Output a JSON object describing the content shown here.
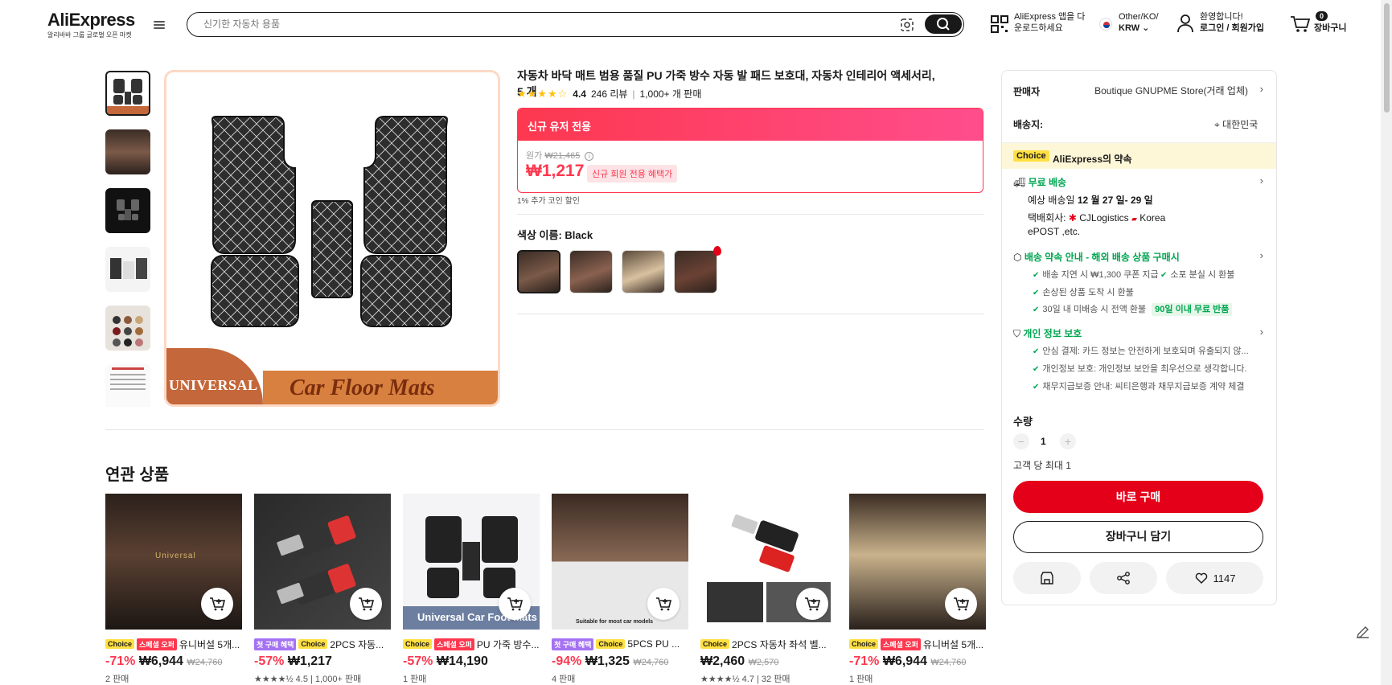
{
  "header": {
    "logo": "AliExpress",
    "logo_sub": "알리바바 그룹 글로벌 오픈 마켓",
    "search_placeholder": "신기한 자동차 용품",
    "app_line1": "AliExpress 앱을 다",
    "app_line2": "운로드하세요",
    "region_line1": "Other/KO/",
    "region_line2": "KRW",
    "account_line1": "환영합니다!",
    "account_line2": "로그인 / 회원가입",
    "cart_count": "0",
    "cart_label": "장바구니"
  },
  "product": {
    "title": "자동차 바닥 매트 범용 품질 PU 가죽 방수 자동 발 패드 보호대, 자동차 인테리어 액세서리, 5 개",
    "rating": "4.4",
    "reviews": "246 리뷰",
    "sold": "1,000+ 개 판매",
    "new_user_header": "신규 유저 전용",
    "orig_label": "원가",
    "orig_price": "₩21,465",
    "price": "₩1,217",
    "price_badge": "신규 회원 전용 혜택가",
    "coin_note": "1% 추가 코인 할인",
    "color_label": "색상 이름: Black",
    "image_banner_left": "UNIVERSAL",
    "image_banner_right": "Car Floor Mats"
  },
  "related": {
    "title": "연관 상품",
    "cards": [
      {
        "tags": [
          "Choice",
          "스페셜 오퍼"
        ],
        "tag_types": [
          "choice",
          "flash"
        ],
        "name": "유니버설 5개...",
        "discount": "-71%",
        "price": "₩6,944",
        "orig": "₩24,760",
        "sold": "2 판매",
        "img_text": "Universal"
      },
      {
        "tags": [
          "첫 구매 혜택",
          "Choice"
        ],
        "tag_types": [
          "first",
          "choice"
        ],
        "name": "2PCS 자동...",
        "discount": "-57%",
        "price": "₩1,217",
        "orig": "",
        "sold": "★★★★½ 4.5 | 1,000+ 판매",
        "img_text": ""
      },
      {
        "tags": [
          "Choice",
          "스페셜 오퍼"
        ],
        "tag_types": [
          "choice",
          "flash"
        ],
        "name": "PU 가죽 방수...",
        "discount": "-57%",
        "price": "₩14,190",
        "orig": "",
        "sold": "1 판매",
        "img_text": "Universal Car Foot Mats"
      },
      {
        "tags": [
          "첫 구매 혜택",
          "Choice"
        ],
        "tag_types": [
          "first",
          "choice"
        ],
        "name": "5PCS PU ...",
        "discount": "-94%",
        "price": "₩1,325",
        "orig": "₩24,760",
        "sold": "4 판매",
        "img_text": "Suitable for most car models"
      },
      {
        "tags": [
          "Choice"
        ],
        "tag_types": [
          "choice"
        ],
        "name": "2PCS 자동차 좌석 벨...",
        "discount": "",
        "price": "₩2,460",
        "orig": "₩2,570",
        "sold": "★★★★½ 4.7 | 32 판매",
        "img_text": ""
      },
      {
        "tags": [
          "Choice",
          "스페셜 오퍼"
        ],
        "tag_types": [
          "choice",
          "flash"
        ],
        "name": "유니버설 5개...",
        "discount": "-71%",
        "price": "₩6,944",
        "orig": "₩24,760",
        "sold": "1 판매",
        "img_text": ""
      }
    ]
  },
  "sidebar": {
    "seller_label": "판매자",
    "seller_name": "Boutique GNUPME Store(거래 업체)",
    "ship_to_label": "배송지:",
    "ship_to": "대한민국",
    "choice": "Choice",
    "promise": "AliExpress의 약속",
    "free_ship": "무료 배송",
    "eta_prefix": "예상 배송일 ",
    "eta": "12 월 27 일- 29 일",
    "carrier_prefix": "택배회사: ",
    "carrier_1": "CJLogistics",
    "carrier_2": "Korea",
    "carrier_3": "ePOST ,etc.",
    "delivery_guide": "배송 약속 안내 - 해외 배송 상품 구매시",
    "g1": "배송 지연 시 ₩1,300 쿠폰 지급",
    "g2": "소포 분실 시 환불",
    "g3": "손상된 상품 도착 시 환불",
    "g4": "30일 내 미배송 시 전액 환불",
    "g4_badge": "90일 이내 무료 반품",
    "privacy": "개인 정보 보호",
    "p1": "안심 결제: 카드 정보는 안전하게 보호되며 유출되지 않...",
    "p2": "개인정보 보호: 개인정보 보안을 최우선으로 생각합니다.",
    "p3": "채무지급보증 안내: 씨티은행과 채무지급보증 계약 체결",
    "qty_label": "수량",
    "qty_value": "1",
    "qty_limit": "고객 당 최대 1",
    "buy_now": "바로 구매",
    "add_cart": "장바구니 담기",
    "wishlist_count": "1147"
  }
}
